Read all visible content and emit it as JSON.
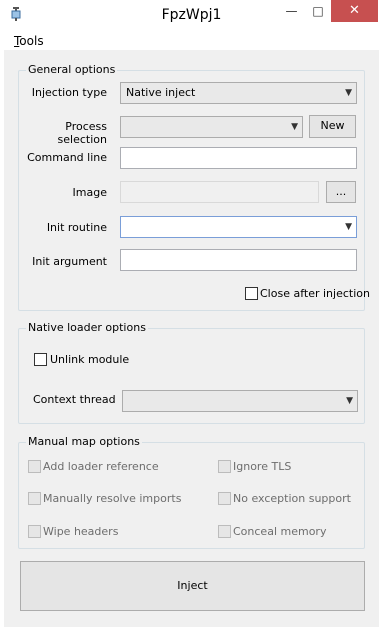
{
  "window": {
    "title": "FpzWpj1",
    "minimize_glyph": "—",
    "maximize_glyph": "□",
    "close_glyph": "✕",
    "app_icon": "syringe-icon"
  },
  "menu": {
    "tools": "Tools"
  },
  "general": {
    "legend": "General options",
    "injection_type_label": "Injection type",
    "injection_type_value": "Native inject",
    "process_selection_label": "Process selection",
    "process_selection_value": "",
    "new_button": "New",
    "command_line_label": "Command line",
    "command_line_value": "",
    "image_label": "Image",
    "image_value": "",
    "browse_button": "...",
    "init_routine_label": "Init routine",
    "init_routine_value": "",
    "init_argument_label": "Init argument",
    "init_argument_value": "",
    "close_after_injection_label": "Close after injection",
    "close_after_injection_checked": false
  },
  "native_loader": {
    "legend": "Native loader options",
    "unlink_module_label": "Unlink module",
    "unlink_module_checked": false,
    "context_thread_label": "Context thread",
    "context_thread_value": ""
  },
  "manual_map": {
    "legend": "Manual map options",
    "add_loader_reference": "Add loader reference",
    "ignore_tls": "Ignore TLS",
    "manually_resolve_imports": "Manually resolve imports",
    "no_exception_support": "No exception support",
    "wipe_headers": "Wipe headers",
    "conceal_memory": "Conceal memory"
  },
  "inject_button": "Inject"
}
